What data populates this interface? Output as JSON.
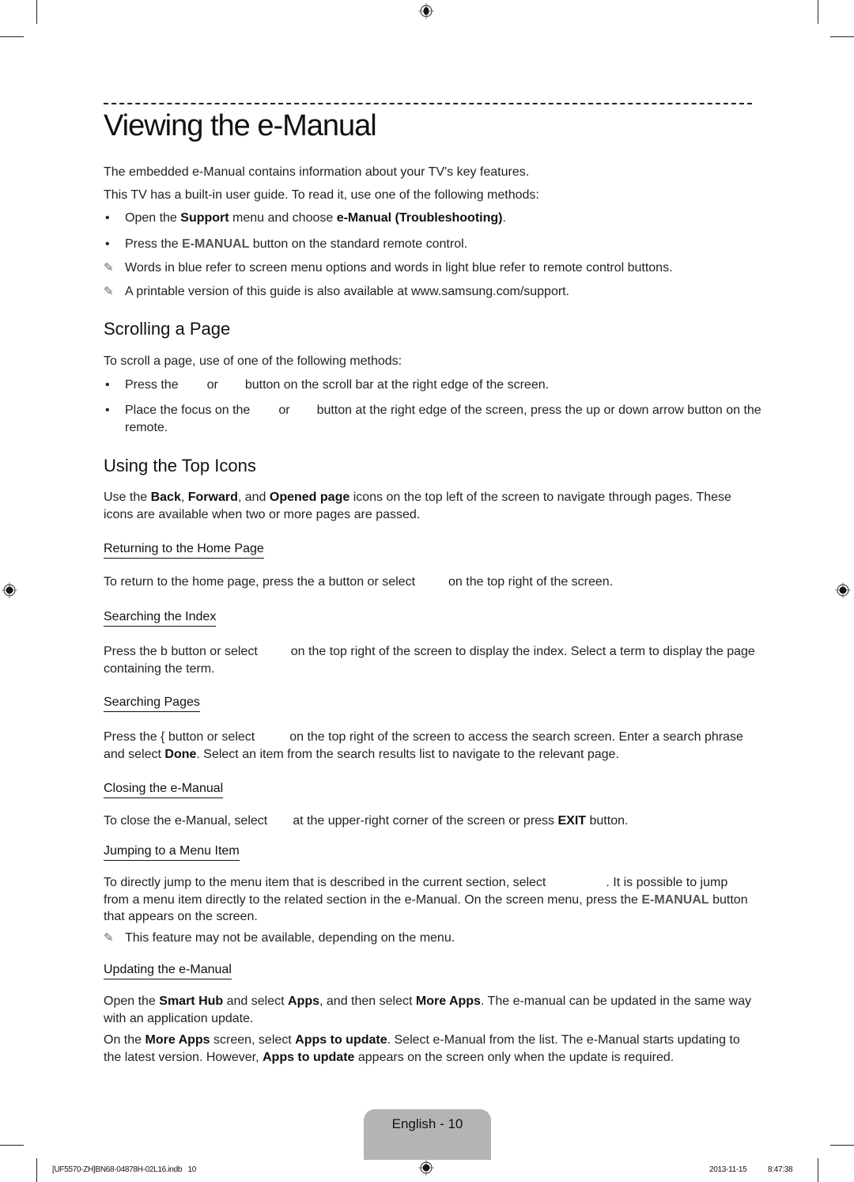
{
  "title": "Viewing the e-Manual",
  "intro": {
    "p1": "The embedded e-Manual contains information about your TV's key features.",
    "p2": "This TV has a built-in user guide. To read it, use one of the following methods:",
    "b1": {
      "pre": "Open the ",
      "k1": "Support",
      "mid": " menu and choose ",
      "k2": "e-Manual (Troubleshooting)",
      "post": "."
    },
    "b2": {
      "pre": "Press the ",
      "k1": "E-MANUAL",
      "post": " button on the standard remote control."
    },
    "n1": "Words in blue refer to screen menu options and words in light blue refer to remote control buttons.",
    "n2": "A printable version of this guide is also available at www.samsung.com/support."
  },
  "scrolling": {
    "heading": "Scrolling a Page",
    "p1": "To scroll a page, use of one of the following methods:",
    "b1": {
      "a": "Press the",
      "b": "or",
      "c": "button on the scroll bar at the right edge of the screen."
    },
    "b2": {
      "a": "Place the focus on the",
      "b": "or",
      "c": "button at the right edge of the screen, press the up or down arrow button on the remote."
    }
  },
  "top_icons": {
    "heading": "Using the Top Icons",
    "p1": {
      "pre": "Use the ",
      "k1": "Back",
      "s1": ", ",
      "k2": "Forward",
      "s2": ", and ",
      "k3": "Opened page",
      "post": " icons on the top left of the screen to navigate through pages. These icons are available when two or more pages are passed."
    }
  },
  "home": {
    "heading": "Returning to the Home Page",
    "a": "To return to the home page, press the a button or select",
    "b": "on the top right of the screen."
  },
  "index": {
    "heading": "Searching the Index",
    "a": "Press the b button or select",
    "b": "on the top right of the screen to display the index. Select a term to display the page containing the term."
  },
  "pages": {
    "heading": "Searching Pages",
    "a": "Press the { button or select",
    "b": "on the top right of the screen to access the search screen. Enter a search phrase and select ",
    "k1": "Done",
    "c": ". Select an item from the search results list to navigate to the relevant page."
  },
  "closing": {
    "heading": "Closing the e-Manual",
    "a": "To close the e-Manual, select",
    "b": "at the upper-right corner of the screen or press ",
    "k1": "EXIT",
    "c": " button."
  },
  "jumping": {
    "heading": "Jumping to a Menu Item",
    "a": "To directly jump to the menu item that is described in the current section, select",
    "b": ". It is possible to jump from a menu item directly to the related section in the e-Manual. On the screen menu, press the ",
    "k1": "E-MANUAL",
    "c": " button that appears on the screen.",
    "note": "This feature may not be available, depending on the menu."
  },
  "updating": {
    "heading": "Updating the e-Manual",
    "p1": {
      "a": "Open the ",
      "k1": "Smart Hub",
      "b": " and select ",
      "k2": "Apps",
      "c": ", and then select ",
      "k3": "More Apps",
      "d": ". The e-manual can be updated in the same way with an application update."
    },
    "p2": {
      "a": "On the ",
      "k1": "More Apps",
      "b": " screen, select ",
      "k2": "Apps to update",
      "c": ". Select e-Manual from the list. The e-Manual starts updating to the latest version. However, ",
      "k3": "Apps to update",
      "d": " appears on the screen only when the update is required."
    }
  },
  "footer": {
    "page_label": "English - 10",
    "file": "[UF5570-ZH]BN68-04878H-02L16.indb   10",
    "date": "2013-11-15",
    "time": "8:47:38"
  },
  "icons": {
    "note": "✎"
  }
}
